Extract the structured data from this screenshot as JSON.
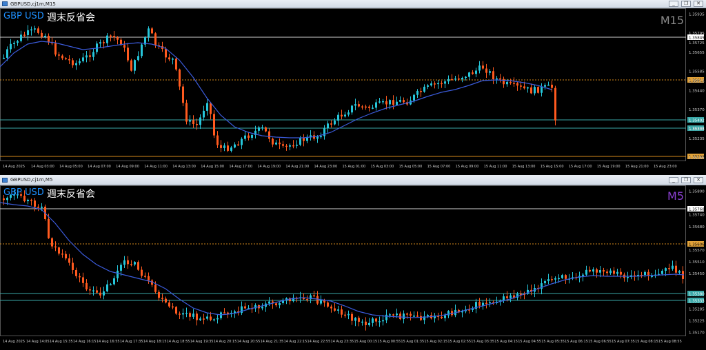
{
  "windows": [
    {
      "title": "GBPUSD,cj1m,M15",
      "symbol": "GBP USD",
      "subtitle": "週末反省会",
      "timeframe": "M15",
      "timeframe_color": "#8a8a8a",
      "price_labels": [
        "1.35935",
        "1.35849",
        "1.35795",
        "1.35725",
        "1.35655",
        "1.35611",
        "1.35585",
        "1.35515",
        "1.35440",
        "1.35402",
        "1.35370",
        "1.35333",
        "1.35305",
        "1.35235",
        "1.35209",
        "1.35165"
      ],
      "time_labels": [
        "14 Aug 2025",
        "14 Aug 03:00",
        "14 Aug 05:00",
        "14 Aug 07:00",
        "14 Aug 09:00",
        "14 Aug 11:00",
        "14 Aug 13:00",
        "14 Aug 15:00",
        "14 Aug 17:00",
        "14 Aug 19:00",
        "14 Aug 21:00",
        "14 Aug 23:00",
        "15 Aug 01:00",
        "15 Aug 03:00",
        "15 Aug 05:00",
        "15 Aug 07:00",
        "15 Aug 09:00",
        "15 Aug 11:00",
        "15 Aug 13:00",
        "15 Aug 15:00",
        "15 Aug 17:00",
        "15 Aug 19:00",
        "15 Aug 21:00",
        "15 Aug 23:00"
      ]
    },
    {
      "title": "GBPUSD,cj1m,M5",
      "symbol": "GBP USD",
      "subtitle": "週末反省会",
      "timeframe": "M5",
      "timeframe_color": "#8a3fd1",
      "price_labels": [
        "1.35800",
        "1.35768",
        "1.35740",
        "1.35680",
        "1.35606",
        "1.35570",
        "1.35510",
        "1.35450",
        "1.35380",
        "1.35333",
        "1.35285",
        "1.35225",
        "1.35170"
      ],
      "time_labels": [
        "14 Aug 2025",
        "14 Aug 14:05",
        "14 Aug 15:35",
        "14 Aug 16:15",
        "14 Aug 16:55",
        "14 Aug 17:35",
        "14 Aug 18:15",
        "14 Aug 18:55",
        "14 Aug 19:35",
        "14 Aug 20:15",
        "14 Aug 20:55",
        "14 Aug 21:35",
        "14 Aug 22:15",
        "14 Aug 22:55",
        "14 Aug 23:35",
        "15 Aug 00:15",
        "15 Aug 00:55",
        "15 Aug 01:35",
        "15 Aug 02:15",
        "15 Aug 02:55",
        "15 Aug 03:35",
        "15 Aug 04:15",
        "15 Aug 04:55",
        "15 Aug 05:35",
        "15 Aug 06:15",
        "15 Aug 06:55",
        "15 Aug 07:35",
        "15 Aug 08:15",
        "15 Aug 08:55"
      ]
    }
  ],
  "colors": {
    "bull": "#26c6da",
    "bear": "#ff5a1f",
    "ma": "#3b5bdb"
  }
}
